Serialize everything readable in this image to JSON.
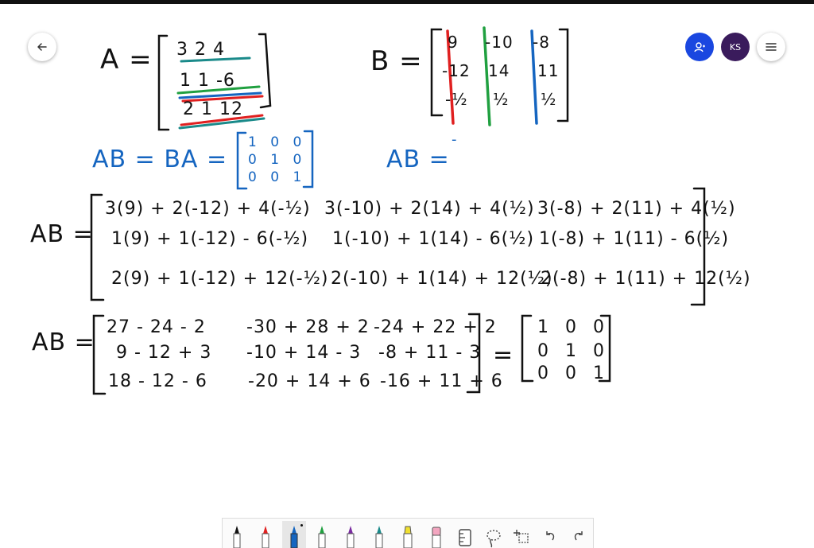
{
  "header": {
    "back_icon": "arrow-left-icon",
    "user_initials": "KS",
    "user_icon": "person-icon",
    "menu_icon": "hamburger-icon",
    "user_button_color": "#1a47e0",
    "ks_button_color": "#3a1b5c"
  },
  "board": {
    "matrixA": {
      "label": "A =",
      "rows": [
        "3  2 4",
        "1  1 -6",
        "2  1 12"
      ]
    },
    "matrixB": {
      "label": "B =",
      "col1": [
        "9",
        "-12",
        "-½"
      ],
      "col2": [
        "-10",
        "14",
        "½"
      ],
      "col3": [
        "-8",
        "11",
        "½"
      ]
    },
    "identity_line": {
      "label": "AB = BA =",
      "rows": [
        "1 0 0",
        "0 1 0",
        "0 0 1"
      ],
      "ab_label": "AB =",
      "ab_mark": "-"
    },
    "expansion": {
      "label": "AB =",
      "rows": [
        [
          "3(9) + 2(-12) + 4(-½)",
          "3(-10) + 2(14) + 4(½)",
          "3(-8) + 2(11) + 4(½)"
        ],
        [
          "1(9) + 1(-12) - 6(-½)",
          "1(-10) + 1(14) - 6(½)",
          "1(-8) + 1(11) - 6(½)"
        ],
        [
          "2(9) + 1(-12) + 12(-½)",
          "2(-10) + 1(14) + 12(½)",
          "2(-8) + 1(11) + 12(½)"
        ]
      ]
    },
    "simplified": {
      "label": "AB =",
      "rows": [
        [
          "27 - 24 - 2",
          "-30 + 28 + 2",
          "-24 + 22 + 2"
        ],
        [
          "9 - 12 + 3",
          "-10 + 14 - 3",
          "-8 + 11 - 3"
        ],
        [
          "18 - 12 - 6",
          "-20 + 14 + 6",
          "-16 + 11 + 6"
        ]
      ],
      "equals": "=",
      "result_rows": [
        "1 0 0",
        "0 1 0",
        "0 0 1"
      ]
    },
    "ink_colors": {
      "black": "#111111",
      "blue": "#1565c0",
      "red": "#e02020",
      "green": "#20a040",
      "teal": "#1a8a8a"
    }
  },
  "toolbar": {
    "tools": [
      {
        "name": "pen-black",
        "color": "#111111",
        "icon": "pen-icon"
      },
      {
        "name": "pen-red",
        "color": "#e02020",
        "icon": "pen-icon"
      },
      {
        "name": "pen-blue",
        "color": "#1565c0",
        "icon": "pen-icon",
        "active": true
      },
      {
        "name": "pen-green",
        "color": "#20a040",
        "icon": "pen-icon"
      },
      {
        "name": "pen-purple",
        "color": "#7a2ca0",
        "icon": "pen-icon"
      },
      {
        "name": "pen-teal",
        "color": "#1a8a8a",
        "icon": "pen-icon"
      },
      {
        "name": "highlighter",
        "color": "#f0e030",
        "icon": "highlighter-icon"
      },
      {
        "name": "eraser",
        "color": "#f3a6c0",
        "icon": "eraser-icon"
      },
      {
        "name": "ruler",
        "color": "#444444",
        "icon": "ruler-icon"
      },
      {
        "name": "lasso",
        "color": "#444444",
        "icon": "lasso-icon"
      },
      {
        "name": "add-shape",
        "color": "#444444",
        "icon": "add-shape-icon"
      },
      {
        "name": "undo",
        "color": "#444444",
        "icon": "undo-icon"
      },
      {
        "name": "redo",
        "color": "#444444",
        "icon": "redo-icon"
      }
    ]
  }
}
